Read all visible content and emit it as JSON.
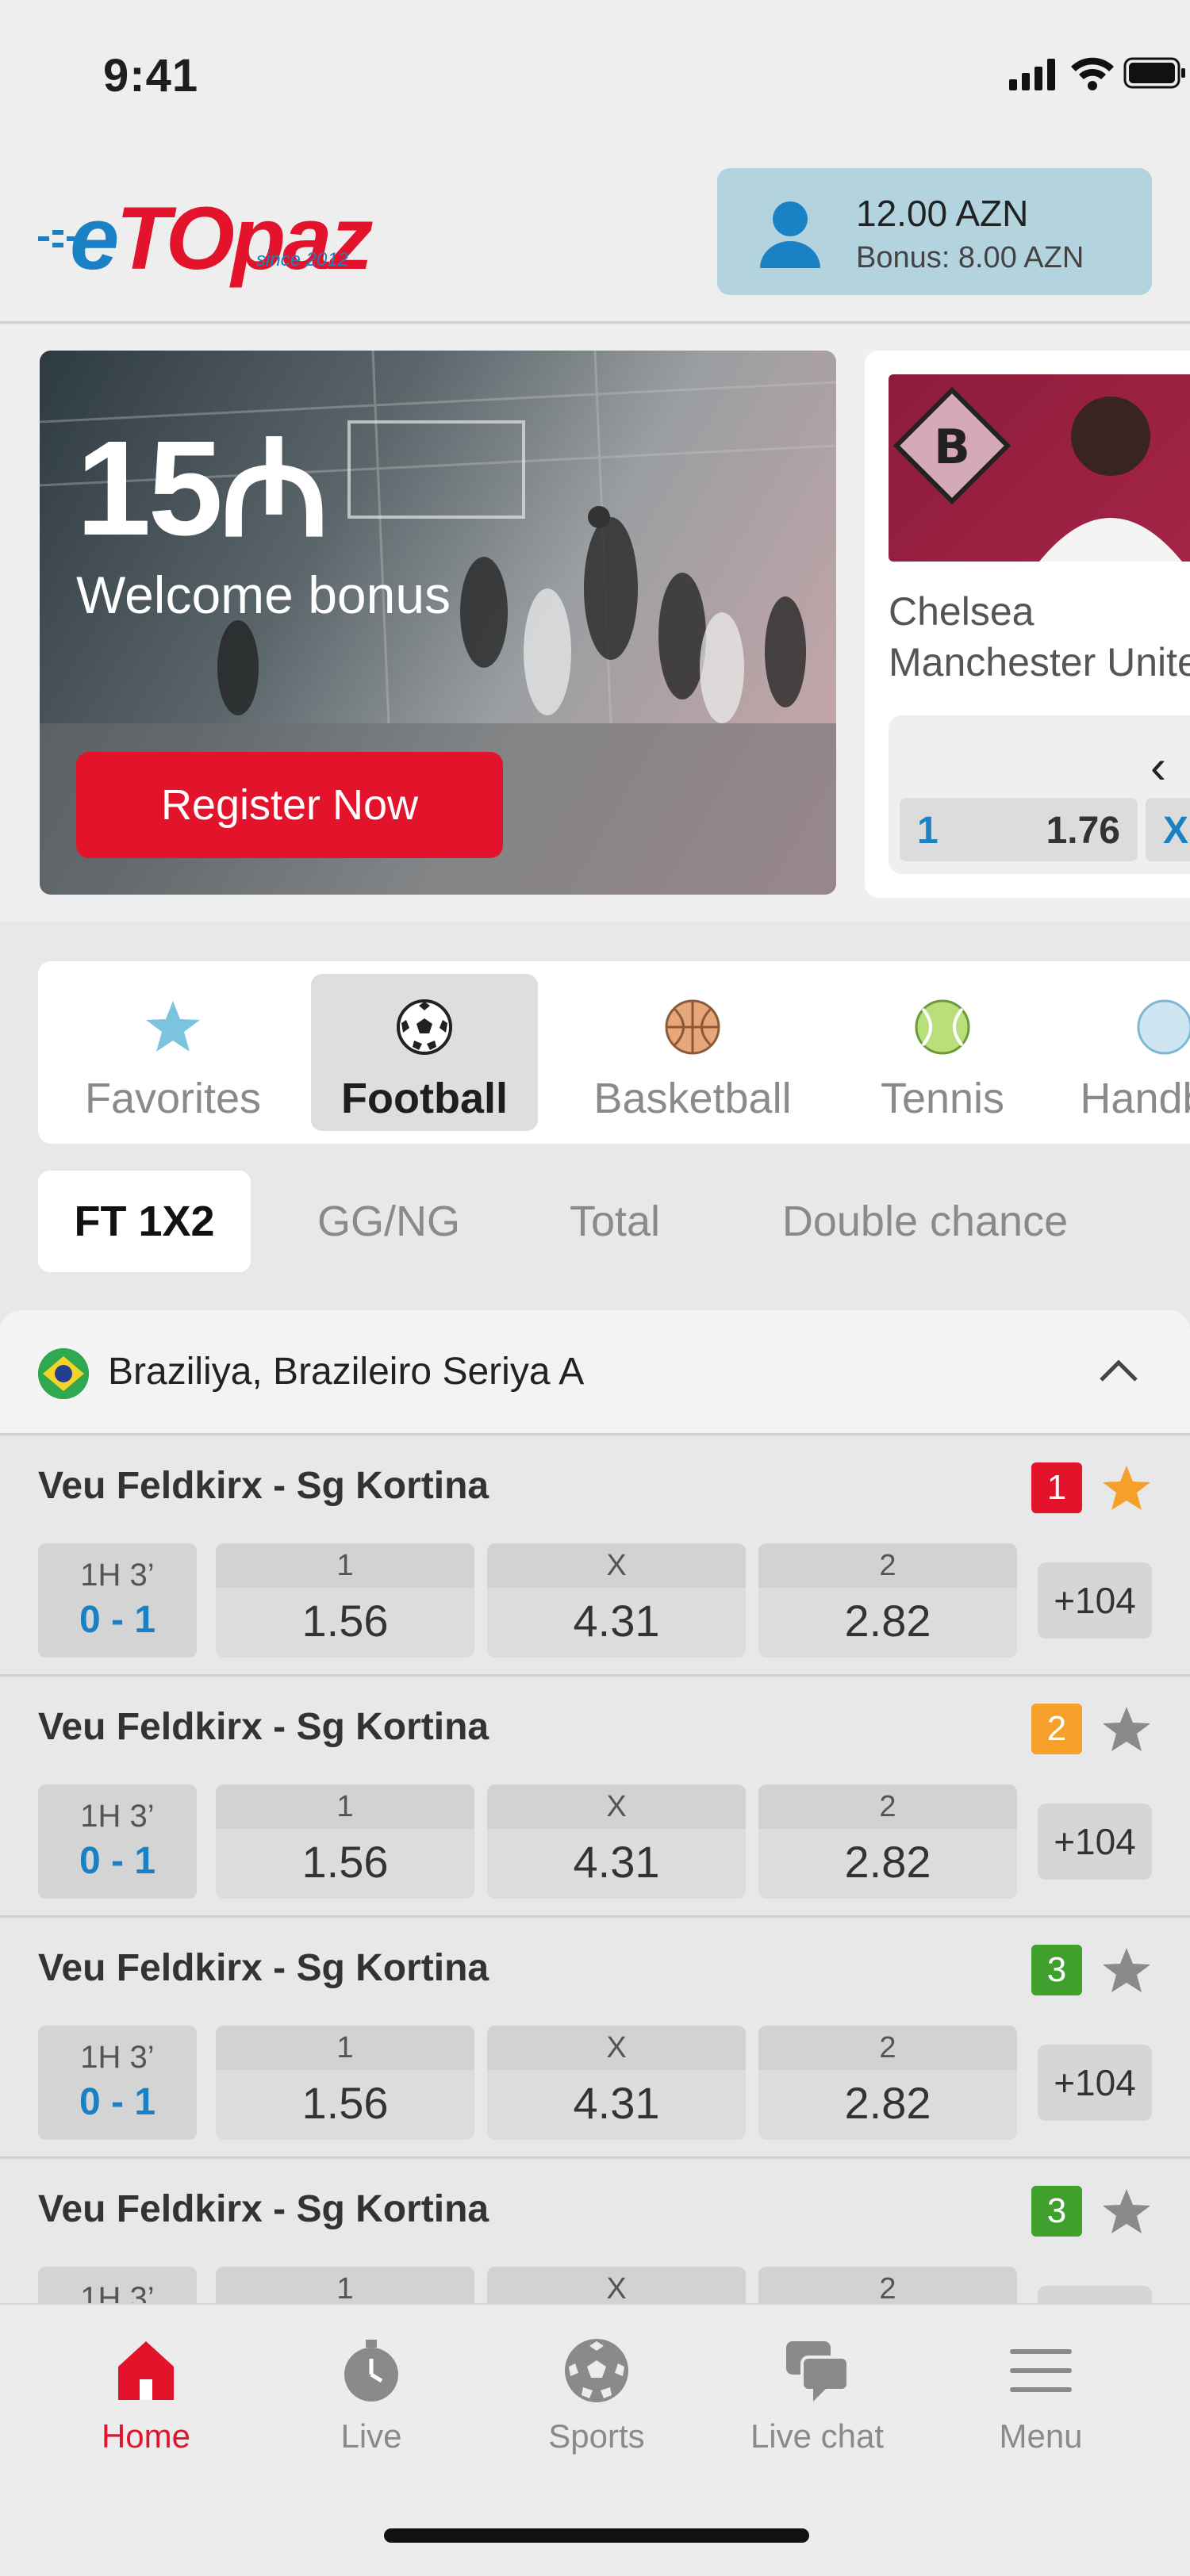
{
  "status_bar": {
    "time": "9:41"
  },
  "header": {
    "logo": {
      "brand": "eTOpaz",
      "tagline": "since 2012"
    },
    "account": {
      "balance": "12.00 AZN",
      "bonus": "Bonus: 8.00 AZN"
    }
  },
  "banners": {
    "promo": {
      "amount": "15₼",
      "title": "Welcome bonus",
      "button": "Register Now"
    },
    "match_card": {
      "team1": "Chelsea",
      "team2": "Manchester United",
      "odds": [
        {
          "label": "1",
          "value": "1.76"
        },
        {
          "label": "X"
        }
      ]
    }
  },
  "sports_tabs": [
    {
      "label": "Favorites",
      "icon": "star-icon",
      "active": false
    },
    {
      "label": "Football",
      "icon": "football-icon",
      "active": true
    },
    {
      "label": "Basketball",
      "icon": "basketball-icon",
      "active": false
    },
    {
      "label": "Tennis",
      "icon": "tennis-icon",
      "active": false
    },
    {
      "label": "Handball",
      "icon": "handball-icon",
      "active": false
    }
  ],
  "market_tabs": [
    {
      "label": "FT 1X2",
      "active": true
    },
    {
      "label": "GG/NG",
      "active": false
    },
    {
      "label": "Total",
      "active": false
    },
    {
      "label": "Double chance",
      "active": false
    }
  ],
  "league": {
    "name": "Braziliya, Brazileiro Seriya A"
  },
  "events": [
    {
      "title": "Veu Feldkirx - Sg Kortina",
      "badge": "1",
      "badge_color": "#e3132b",
      "favorite": true,
      "time": "1H 3’",
      "score": "0 - 1",
      "odds": [
        {
          "label": "1",
          "value": "1.56"
        },
        {
          "label": "X",
          "value": "4.31"
        },
        {
          "label": "2",
          "value": "2.82"
        }
      ],
      "more": "+104"
    },
    {
      "title": "Veu Feldkirx - Sg Kortina",
      "badge": "2",
      "badge_color": "#f5a02b",
      "favorite": false,
      "time": "1H 3’",
      "score": "0 - 1",
      "odds": [
        {
          "label": "1",
          "value": "1.56"
        },
        {
          "label": "X",
          "value": "4.31"
        },
        {
          "label": "2",
          "value": "2.82"
        }
      ],
      "more": "+104"
    },
    {
      "title": "Veu Feldkirx - Sg Kortina",
      "badge": "3",
      "badge_color": "#3fa02e",
      "favorite": false,
      "time": "1H 3’",
      "score": "0 - 1",
      "odds": [
        {
          "label": "1",
          "value": "1.56"
        },
        {
          "label": "X",
          "value": "4.31"
        },
        {
          "label": "2",
          "value": "2.82"
        }
      ],
      "more": "+104"
    },
    {
      "title": "Veu Feldkirx - Sg Kortina",
      "badge": "3",
      "badge_color": "#3fa02e",
      "favorite": false,
      "time": "1H 3’",
      "score": "",
      "odds": [
        {
          "label": "1",
          "value": ""
        },
        {
          "label": "X",
          "value": ""
        },
        {
          "label": "2",
          "value": ""
        }
      ],
      "more": ""
    }
  ],
  "bottom_nav": [
    {
      "label": "Home",
      "icon": "home-icon",
      "active": true
    },
    {
      "label": "Live",
      "icon": "stopwatch-icon",
      "active": false
    },
    {
      "label": "Sports",
      "icon": "football-icon",
      "active": false
    },
    {
      "label": "Live chat",
      "icon": "chat-icon",
      "active": false
    },
    {
      "label": "Menu",
      "icon": "hamburger-icon",
      "active": false
    }
  ],
  "colors": {
    "brand_red": "#e3132b",
    "brand_blue": "#1a82c4",
    "account_bg": "#b3d4df"
  }
}
